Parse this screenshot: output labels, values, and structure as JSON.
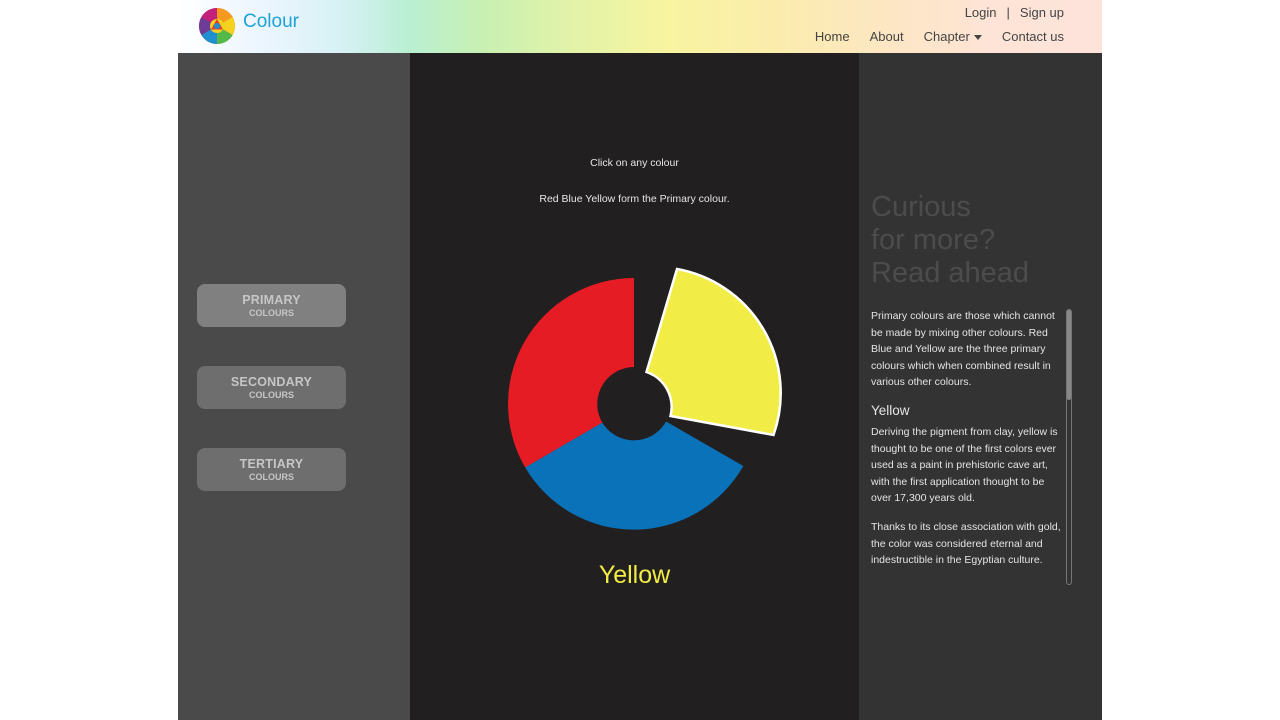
{
  "header": {
    "brand": "Colour",
    "login": "Login",
    "separator": "|",
    "signup": "Sign up",
    "nav": {
      "home": "Home",
      "about": "About",
      "chapter": "Chapter",
      "contact": "Contact us"
    }
  },
  "sidebar": {
    "buttons": [
      {
        "title": "PRIMARY",
        "subtitle": "COLOURS",
        "active": true
      },
      {
        "title": "SECONDARY",
        "subtitle": "COLOURS",
        "active": false
      },
      {
        "title": "TERTIARY",
        "subtitle": "COLOURS",
        "active": false
      }
    ]
  },
  "main": {
    "instruction": "Click on any colour",
    "description": "Red Blue Yellow form the Primary colour.",
    "selected_colour": "Yellow",
    "wheel": [
      {
        "name": "red",
        "color": "#e61c24"
      },
      {
        "name": "blue",
        "color": "#0a72b8"
      },
      {
        "name": "yellow",
        "color": "#f2ec46",
        "selected": true
      }
    ]
  },
  "info": {
    "heading_line1": "Curious",
    "heading_line2": "for more?",
    "heading_line3": "Read ahead",
    "intro": "Primary colours are those which cannot be made by mixing other colours. Red Blue and Yellow are the three primary colours which when combined result in various other colours.",
    "subheading": "Yellow",
    "paragraph1": "Deriving the pigment from clay, yellow is thought to be one of the first colors ever used as a paint in prehistoric cave art, with the first application thought to be over 17,300 years old.",
    "paragraph2": "Thanks to its close association with gold, the color was considered eternal and indestructible in the Egyptian culture."
  }
}
